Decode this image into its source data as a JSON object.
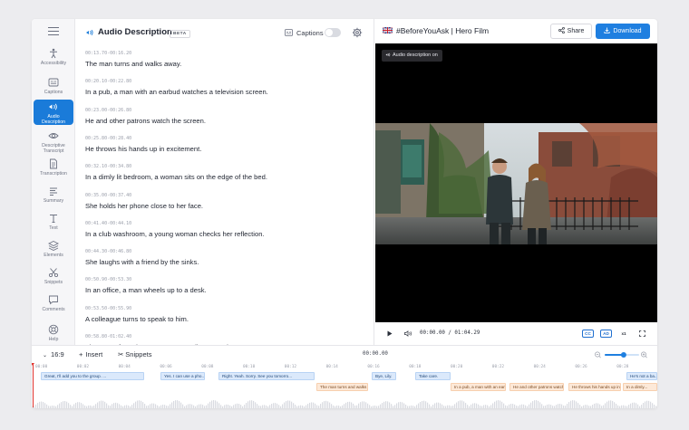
{
  "sidebar": {
    "items": [
      {
        "label": "Accessibility",
        "icon": "accessibility-icon"
      },
      {
        "label": "Captions",
        "icon": "captions-icon"
      },
      {
        "label": "Audio\nDescription",
        "icon": "audio-description-icon",
        "active": true
      },
      {
        "label": "Descriptive\nTranscript",
        "icon": "eye-icon"
      },
      {
        "label": "Transcription",
        "icon": "document-icon"
      },
      {
        "label": "Summary",
        "icon": "summary-icon"
      },
      {
        "label": "Text",
        "icon": "text-icon"
      },
      {
        "label": "Elements",
        "icon": "layers-icon"
      },
      {
        "label": "Snippets",
        "icon": "scissors-icon"
      },
      {
        "label": "Comments",
        "icon": "comment-icon"
      },
      {
        "label": "Help",
        "icon": "help-icon"
      }
    ]
  },
  "editor": {
    "title": "Audio Description",
    "badge": "BETA",
    "captions_label": "Captions",
    "captions_on": false,
    "segments": [
      {
        "timecode": "00:13.70-00:16.20",
        "text": "The man turns and walks away."
      },
      {
        "timecode": "00:20.10-00:22.80",
        "text": "In a pub, a man with an earbud watches a television screen."
      },
      {
        "timecode": "00:23.00-00:26.80",
        "text": "He and other patrons watch the screen."
      },
      {
        "timecode": "00:25.80-00:28.40",
        "text": "He throws his hands up in excitement."
      },
      {
        "timecode": "00:32.10-00:34.80",
        "text": "In a dimly lit bedroom, a woman sits on the edge of the bed."
      },
      {
        "timecode": "00:35.00-00:37.40",
        "text": "She holds her phone close to her face."
      },
      {
        "timecode": "00:41.40-00:44.10",
        "text": "In a club washroom, a young woman checks her reflection."
      },
      {
        "timecode": "00:44.30-00:46.80",
        "text": "She laughs with a friend by the sinks."
      },
      {
        "timecode": "00:50.90-00:53.30",
        "text": "In an office, a man wheels up to a desk."
      },
      {
        "timecode": "00:53.50-00:55.90",
        "text": "A colleague turns to speak to him."
      },
      {
        "timecode": "00:58.80-01:02.40",
        "text": "The group from the street corner walk on together."
      }
    ]
  },
  "header": {
    "flag": "uk-flag-icon",
    "project_title": "#BeforeYouAsk | Hero Film",
    "share_label": "Share",
    "download_label": "Download",
    "accent": "#1f7fe0"
  },
  "player": {
    "badge": "Audio description on",
    "current_time": "00:00.00",
    "separator": "/",
    "duration": "01:04.29",
    "cc_label": "CC",
    "ad_label": "AD",
    "speed_label": "x1"
  },
  "timeline": {
    "aspect_ratio": "16:9",
    "insert_label": "Insert",
    "snippets_label": "Snippets",
    "current_time": "00:00.00",
    "zoom_level": 0.55,
    "ticks": [
      "00:00",
      "00:02",
      "00:04",
      "00:06",
      "00:08",
      "00:10",
      "00:12",
      "00:14",
      "00:16",
      "00:18",
      "00:20",
      "00:22",
      "00:24",
      "00:26",
      "00:28",
      "00:30"
    ],
    "caption_track": [
      "Great, I'll add you to the group. ...",
      "Yes. I can use a pho...",
      "Right. Yeah. Sorry. See you tomorro...",
      "Bye, Lily.",
      "Take care.",
      "He's not a ba..."
    ],
    "description_track": [
      "The man turns and walks away.",
      "In a pub, a man with an earbud...",
      "He and other patrons watch...",
      "He throws his hands up in e...",
      "In a dimly..."
    ]
  }
}
